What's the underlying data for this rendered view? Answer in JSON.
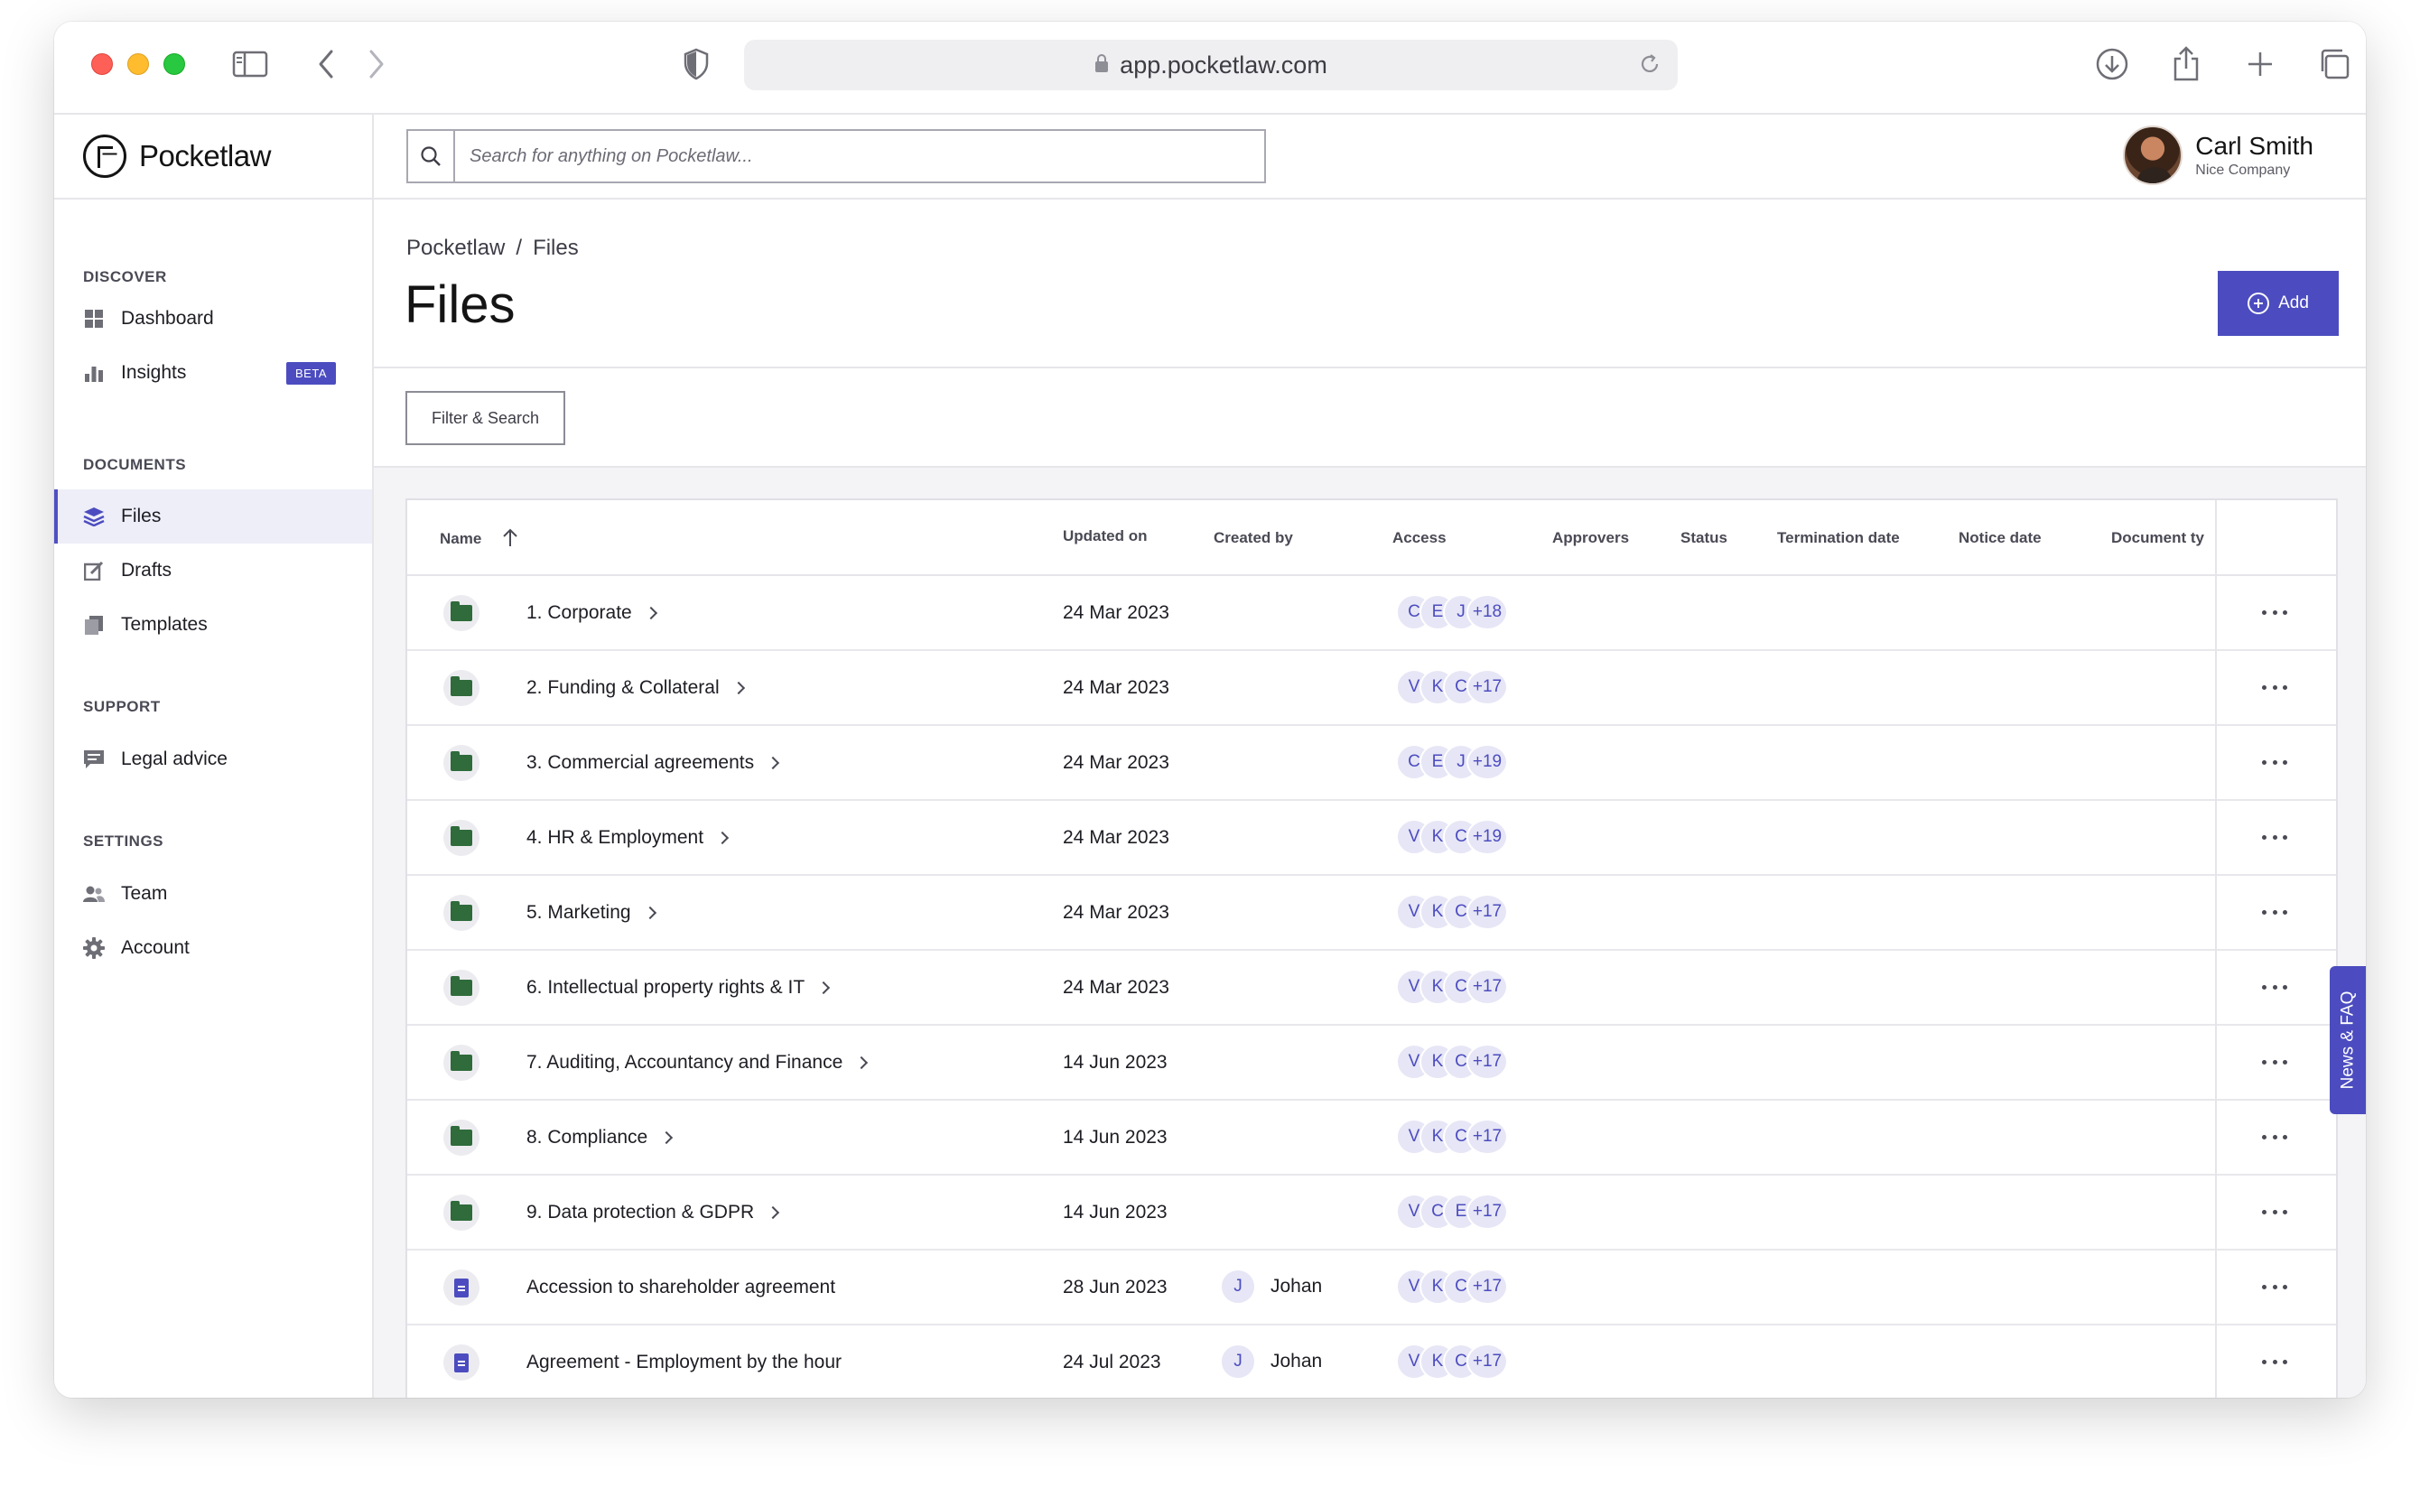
{
  "browser": {
    "url": "app.pocketlaw.com"
  },
  "brand": {
    "name": "Pocketlaw",
    "accent": "#4c4cc0",
    "folder_color": "#2f6b3b"
  },
  "search": {
    "placeholder": "Search for anything on Pocketlaw..."
  },
  "user": {
    "name": "Carl Smith",
    "company": "Nice Company"
  },
  "sidebar": {
    "sections": [
      {
        "title": "DISCOVER"
      },
      {
        "title": "DOCUMENTS"
      },
      {
        "title": "SUPPORT"
      },
      {
        "title": "SETTINGS"
      }
    ],
    "items": [
      {
        "label": "Dashboard",
        "icon": "dashboard-icon"
      },
      {
        "label": "Insights",
        "icon": "insights-icon",
        "badge": "BETA"
      },
      {
        "label": "Files",
        "icon": "layers-icon",
        "active": true
      },
      {
        "label": "Drafts",
        "icon": "edit-icon"
      },
      {
        "label": "Templates",
        "icon": "templates-icon"
      },
      {
        "label": "Legal advice",
        "icon": "chat-icon"
      },
      {
        "label": "Team",
        "icon": "team-icon"
      },
      {
        "label": "Account",
        "icon": "gear-icon"
      }
    ]
  },
  "page": {
    "breadcrumb": [
      "Pocketlaw",
      "Files"
    ],
    "breadcrumb_sep": "/",
    "title": "Files",
    "add_label": "Add",
    "filter_label": "Filter & Search"
  },
  "table": {
    "columns": [
      "Name",
      "Updated on",
      "Created by",
      "Access",
      "Approvers",
      "Status",
      "Termination date",
      "Notice date",
      "Document ty"
    ],
    "rows": [
      {
        "type": "folder",
        "name": "1. Corporate",
        "updated": "24 Mar 2023",
        "creator": "",
        "access": [
          "C",
          "E",
          "J"
        ],
        "access_more": "+18"
      },
      {
        "type": "folder",
        "name": "2. Funding & Collateral",
        "updated": "24 Mar 2023",
        "creator": "",
        "access": [
          "V",
          "K",
          "C"
        ],
        "access_more": "+17"
      },
      {
        "type": "folder",
        "name": "3. Commercial agreements",
        "updated": "24 Mar 2023",
        "creator": "",
        "access": [
          "C",
          "E",
          "J"
        ],
        "access_more": "+19"
      },
      {
        "type": "folder",
        "name": "4. HR & Employment",
        "updated": "24 Mar 2023",
        "creator": "",
        "access": [
          "V",
          "K",
          "C"
        ],
        "access_more": "+19"
      },
      {
        "type": "folder",
        "name": "5. Marketing",
        "updated": "24 Mar 2023",
        "creator": "",
        "access": [
          "V",
          "K",
          "C"
        ],
        "access_more": "+17"
      },
      {
        "type": "folder",
        "name": "6. Intellectual property rights & IT",
        "updated": "24 Mar 2023",
        "creator": "",
        "access": [
          "V",
          "K",
          "C"
        ],
        "access_more": "+17"
      },
      {
        "type": "folder",
        "name": "7. Auditing, Accountancy and Finance",
        "updated": "14 Jun 2023",
        "creator": "",
        "access": [
          "V",
          "K",
          "C"
        ],
        "access_more": "+17"
      },
      {
        "type": "folder",
        "name": "8. Compliance",
        "updated": "14 Jun 2023",
        "creator": "",
        "access": [
          "V",
          "K",
          "C"
        ],
        "access_more": "+17"
      },
      {
        "type": "folder",
        "name": "9. Data protection & GDPR",
        "updated": "14 Jun 2023",
        "creator": "",
        "access": [
          "V",
          "C",
          "E"
        ],
        "access_more": "+17"
      },
      {
        "type": "document",
        "name": "Accession to shareholder agreement",
        "updated": "28 Jun 2023",
        "creator": "Johan",
        "creator_initial": "J",
        "access": [
          "V",
          "K",
          "C"
        ],
        "access_more": "+17"
      },
      {
        "type": "document",
        "name": "Agreement - Employment by the hour",
        "updated": "24 Jul 2023",
        "creator": "Johan",
        "creator_initial": "J",
        "access": [
          "V",
          "K",
          "C"
        ],
        "access_more": "+17"
      }
    ]
  },
  "side_tab": {
    "label": "News & FAQ"
  }
}
